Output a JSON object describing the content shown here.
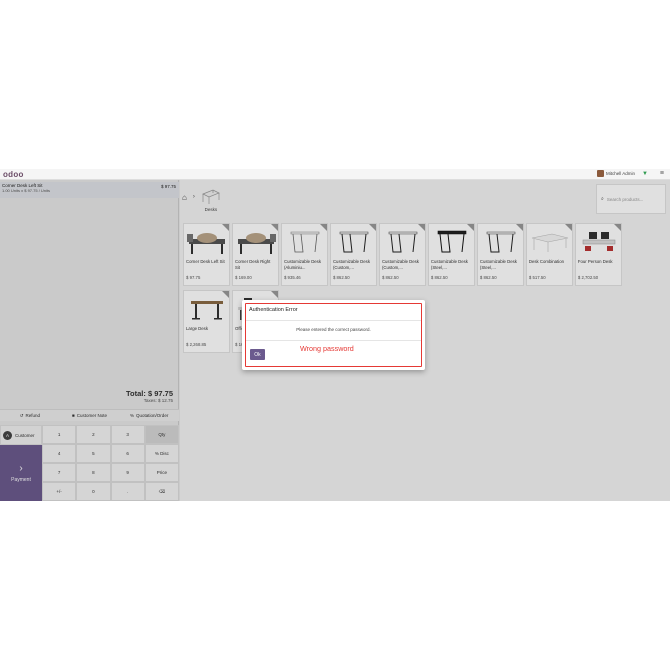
{
  "navbar": {
    "logo": "odoo",
    "user_name": "Mitchell Admin"
  },
  "order": {
    "line_name": "Corner Desk Left Sit",
    "line_price": "$ 97.75",
    "line_detail": "1.00 Units x $ 97.75 / Units",
    "total": "Total: $ 97.75",
    "taxes": "Taxes: $ 12.75"
  },
  "controls": {
    "refund": "Refund",
    "customer_note": "Customer Note",
    "quotation": "Quotation/Order"
  },
  "pad": {
    "customer": "Customer",
    "customer_initial": "A",
    "payment": "Payment",
    "keys": [
      "1",
      "2",
      "3",
      "Qty",
      "4",
      "5",
      "6",
      "% Disc",
      "7",
      "8",
      "9",
      "Price",
      "+/-",
      "0",
      ".",
      "⌫"
    ]
  },
  "products_panel": {
    "category": "Desks",
    "search_placeholder": "Search products..."
  },
  "products": [
    {
      "name": "Corner Desk Left Sit",
      "price": "$ 97.75"
    },
    {
      "name": "Corner Desk Right Sit",
      "price": "$ 169.00"
    },
    {
      "name": "Customizable Desk (Aluminiu...",
      "price": "$ 935.46"
    },
    {
      "name": "Customizable Desk (Custom,...",
      "price": "$ 862.50"
    },
    {
      "name": "Customizable Desk (Custom,...",
      "price": "$ 862.50"
    },
    {
      "name": "Customizable Desk (Steel,...",
      "price": "$ 862.50"
    },
    {
      "name": "Customizable Desk (Steel,...",
      "price": "$ 862.50"
    },
    {
      "name": "Desk Combination",
      "price": "$ 517.50"
    },
    {
      "name": "Four Person Desk",
      "price": "$ 2,702.50"
    },
    {
      "name": "Large Desk",
      "price": "$ 2,268.85"
    },
    {
      "name": "Office combo",
      "price": "$ 160.00"
    }
  ],
  "dialog": {
    "title": "Authentication Error",
    "message": "Please entered the correct password.",
    "ok": "Ok",
    "annotation": "Wrong password"
  },
  "colors": {
    "primary": "#6b5a8e",
    "error": "#e53935"
  }
}
